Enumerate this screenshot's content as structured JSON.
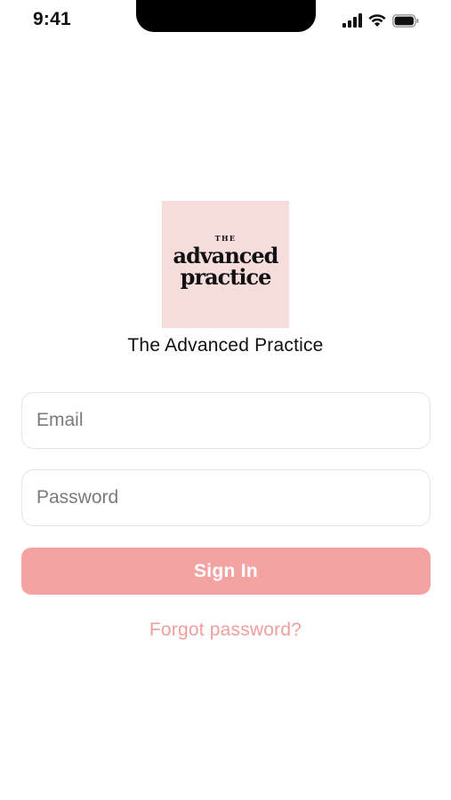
{
  "status_bar": {
    "time": "9:41",
    "icons": [
      "cellular-signal-icon",
      "wifi-icon",
      "battery-icon"
    ]
  },
  "logo": {
    "small": "THE",
    "line1": "advanced",
    "line2": "practice",
    "background": "#f7dcdc"
  },
  "app_title": "The Advanced Practice",
  "form": {
    "email_placeholder": "Email",
    "password_placeholder": "Password",
    "signin_label": "Sign In",
    "forgot_label": "Forgot password?"
  },
  "colors": {
    "accent": "#f4a3a3",
    "link": "#f09e9e"
  }
}
